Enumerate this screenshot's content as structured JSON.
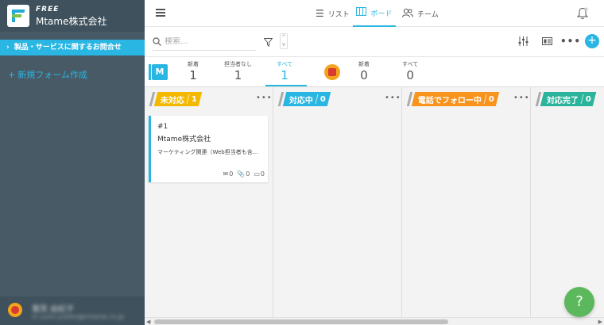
{
  "sidebar": {
    "plan": "FREE",
    "company": "Mtame株式会社",
    "form_item": "製品・サービスに関するお問合せ",
    "new_form": "新規フォーム作成",
    "user_name": "鷲見 由紀子",
    "user_email": "m.sumi.yukiko@mtame.co.jp"
  },
  "topbar": {
    "tabs": [
      {
        "label": "リスト",
        "icon": "list-icon"
      },
      {
        "label": "ボード",
        "icon": "board-icon",
        "active": true
      },
      {
        "label": "チーム",
        "icon": "team-icon"
      }
    ]
  },
  "toolbar": {
    "search_placeholder": "検索..."
  },
  "stats": {
    "team_badge": "M",
    "team": [
      {
        "label": "新着",
        "value": "1"
      },
      {
        "label": "担当者なし",
        "value": "1"
      },
      {
        "label": "すべて",
        "value": "1",
        "active": true
      }
    ],
    "mine": [
      {
        "label": "新着",
        "value": "0"
      },
      {
        "label": "すべて",
        "value": "0"
      }
    ]
  },
  "board": {
    "columns": [
      {
        "label": "未対応",
        "count": "1",
        "color": "#f5b800"
      },
      {
        "label": "対応中",
        "count": "0",
        "color": "#29b6e3"
      },
      {
        "label": "電話でフォロー中",
        "count": "0",
        "color": "#f7941d"
      },
      {
        "label": "対応完了",
        "count": "0",
        "color": "#2bb39b"
      }
    ],
    "cards": [
      {
        "number": "#1",
        "title": "Mtame株式会社",
        "description": "マーケティング関連（Web担当者も含...",
        "emails": "0",
        "attachments": "0",
        "notes": "0"
      }
    ]
  },
  "help": {
    "label": "?"
  },
  "colors": {
    "accent": "#29b6e3",
    "sidebar": "#485a66",
    "help": "#5cb85c"
  }
}
